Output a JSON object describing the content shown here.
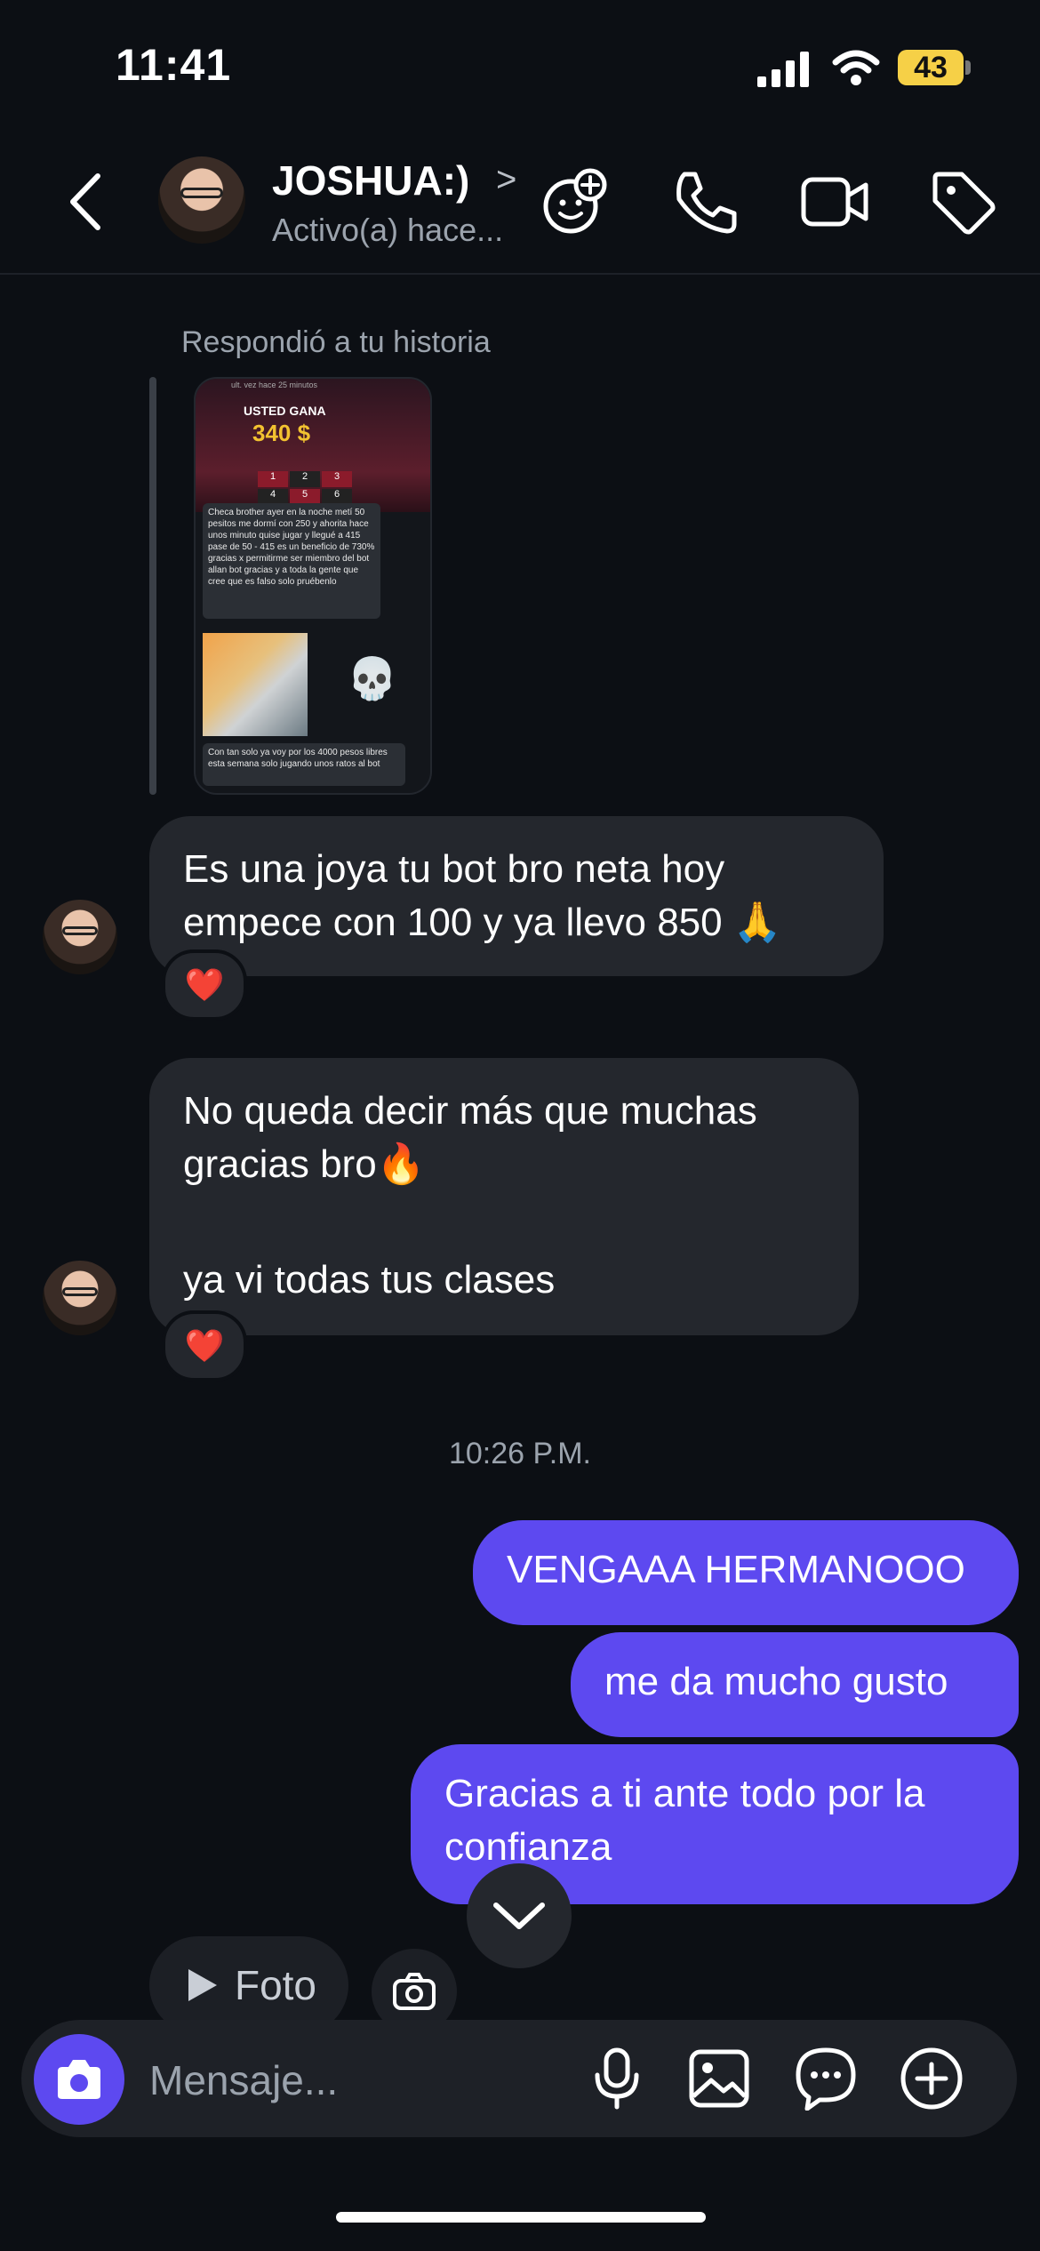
{
  "status_bar": {
    "time": "11:41",
    "battery": "43"
  },
  "header": {
    "contact_name": "JOSHUA:)",
    "contact_status": "Activo(a) hace...",
    "icons": [
      "back-icon",
      "effects-icon",
      "phone-icon",
      "video-icon",
      "tag-icon"
    ]
  },
  "story_reply": {
    "label": "Respondió a tu historia",
    "preview": {
      "top_line": "ult. vez hace 25 minutos",
      "win_label": "USTED GANA",
      "amount": "340 $",
      "message_1": "Checa brother ayer en la noche metí 50 pesitos me dormí con 250 y ahorita hace unos minuto quise jugar y llegué a 415 pase de 50 - 415 es un beneficio de 730% gracias x permitirme ser miembro del bot allan bot gracias y a toda la gente que cree que es falso solo pruébenlo",
      "message_2": "Con tan solo ya voy por los 4000 pesos libres esta semana solo jugando unos ratos al bot",
      "skull": "💀"
    }
  },
  "messages": [
    {
      "direction": "in",
      "text": "Es una joya tu bot bro neta hoy empece con 100 y ya llevo 850 🙏",
      "reaction": "❤️"
    },
    {
      "direction": "in",
      "text_line_1": "No queda decir más que muchas gracias bro🔥",
      "text_line_2": "ya vi todas tus clases",
      "reaction": "❤️"
    },
    {
      "direction": "out",
      "text": "VENGAAA HERMANOOO"
    },
    {
      "direction": "out",
      "text": "me da mucho gusto"
    },
    {
      "direction": "out",
      "text": "Gracias a ti ante todo por la confianza"
    }
  ],
  "timestamp": "10:26 P.M.",
  "quick_actions": {
    "photo_label": "Foto"
  },
  "composer": {
    "placeholder": "Mensaje...",
    "icons": [
      "camera-icon",
      "microphone-icon",
      "gallery-icon",
      "sticker-icon",
      "plus-icon"
    ]
  },
  "colors": {
    "background": "#0c0f14",
    "incoming_bubble": "#24272d",
    "outgoing_bubble": "#5d49f0",
    "battery": "#f6d047"
  }
}
